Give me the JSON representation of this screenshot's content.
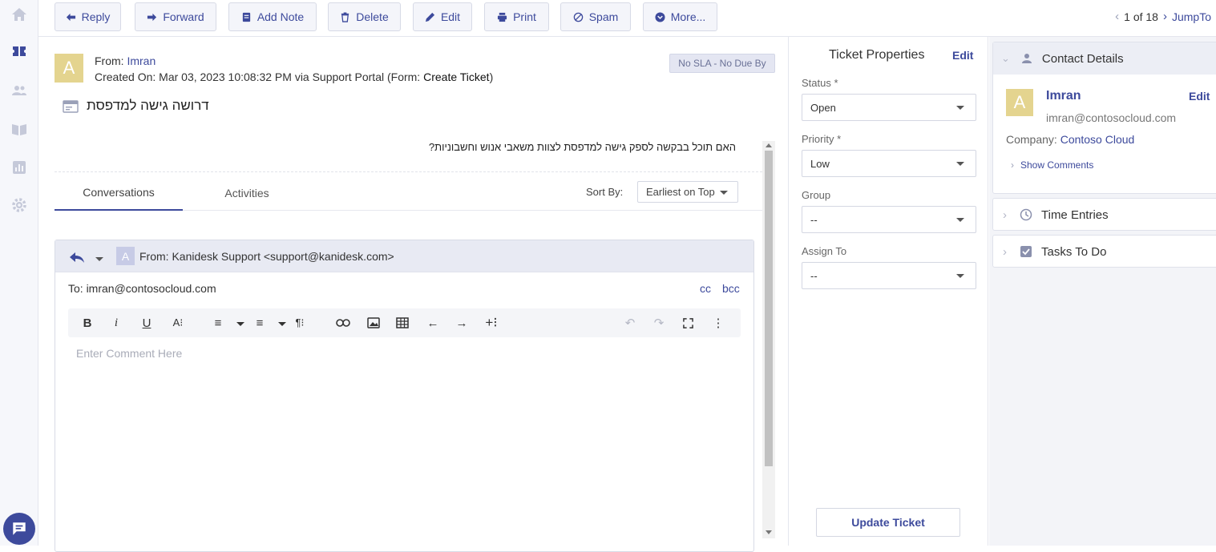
{
  "toolbar": {
    "reply": "Reply",
    "forward": "Forward",
    "add_note": "Add Note",
    "delete": "Delete",
    "edit": "Edit",
    "print": "Print",
    "spam": "Spam",
    "more": "More...",
    "pager": "1 of 18",
    "jump_to": "JumpTo"
  },
  "ticket": {
    "avatar_letter": "A",
    "from_label": "From:",
    "from_name": "Imran",
    "created_prefix": "Created On: Mar 03, 2023 10:08:32 PM via Support Portal (Form: ",
    "form_name": "Create Ticket",
    "created_suffix": ")",
    "sla": "No SLA - No Due By",
    "subject": "דרושה גישה למדפסת",
    "body": "האם תוכל בבקשה לספק גישה למדפסת לצוות משאבי אנוש וחשבוניות?"
  },
  "tabs": {
    "conversations": "Conversations",
    "activities": "Activities",
    "sort_label": "Sort By:",
    "sort_value": "Earliest on Top"
  },
  "reply": {
    "avatar_letter": "A",
    "from": "From: Kanidesk Support <support@kanidesk.com>",
    "to": "To: imran@contosocloud.com",
    "cc": "cc",
    "bcc": "bcc",
    "placeholder": "Enter Comment Here"
  },
  "properties": {
    "title": "Ticket Properties",
    "edit": "Edit",
    "status_label": "Status",
    "status_value": "Open",
    "priority_label": "Priority",
    "priority_value": "Low",
    "group_label": "Group",
    "group_value": "--",
    "assign_label": "Assign To",
    "assign_value": "--",
    "required_mark": "*",
    "update_button": "Update Ticket"
  },
  "contact": {
    "title": "Contact Details",
    "avatar_letter": "A",
    "name": "Imran",
    "edit": "Edit",
    "email": "imran@contosocloud.com",
    "company_label": "Company:",
    "company_name": "Contoso Cloud",
    "show_comments": "Show Comments"
  },
  "panels": {
    "time_entries": "Time Entries",
    "tasks": "Tasks To Do"
  },
  "colors": {
    "accent": "#3d4a9c",
    "avatar": "#e4d48f"
  }
}
